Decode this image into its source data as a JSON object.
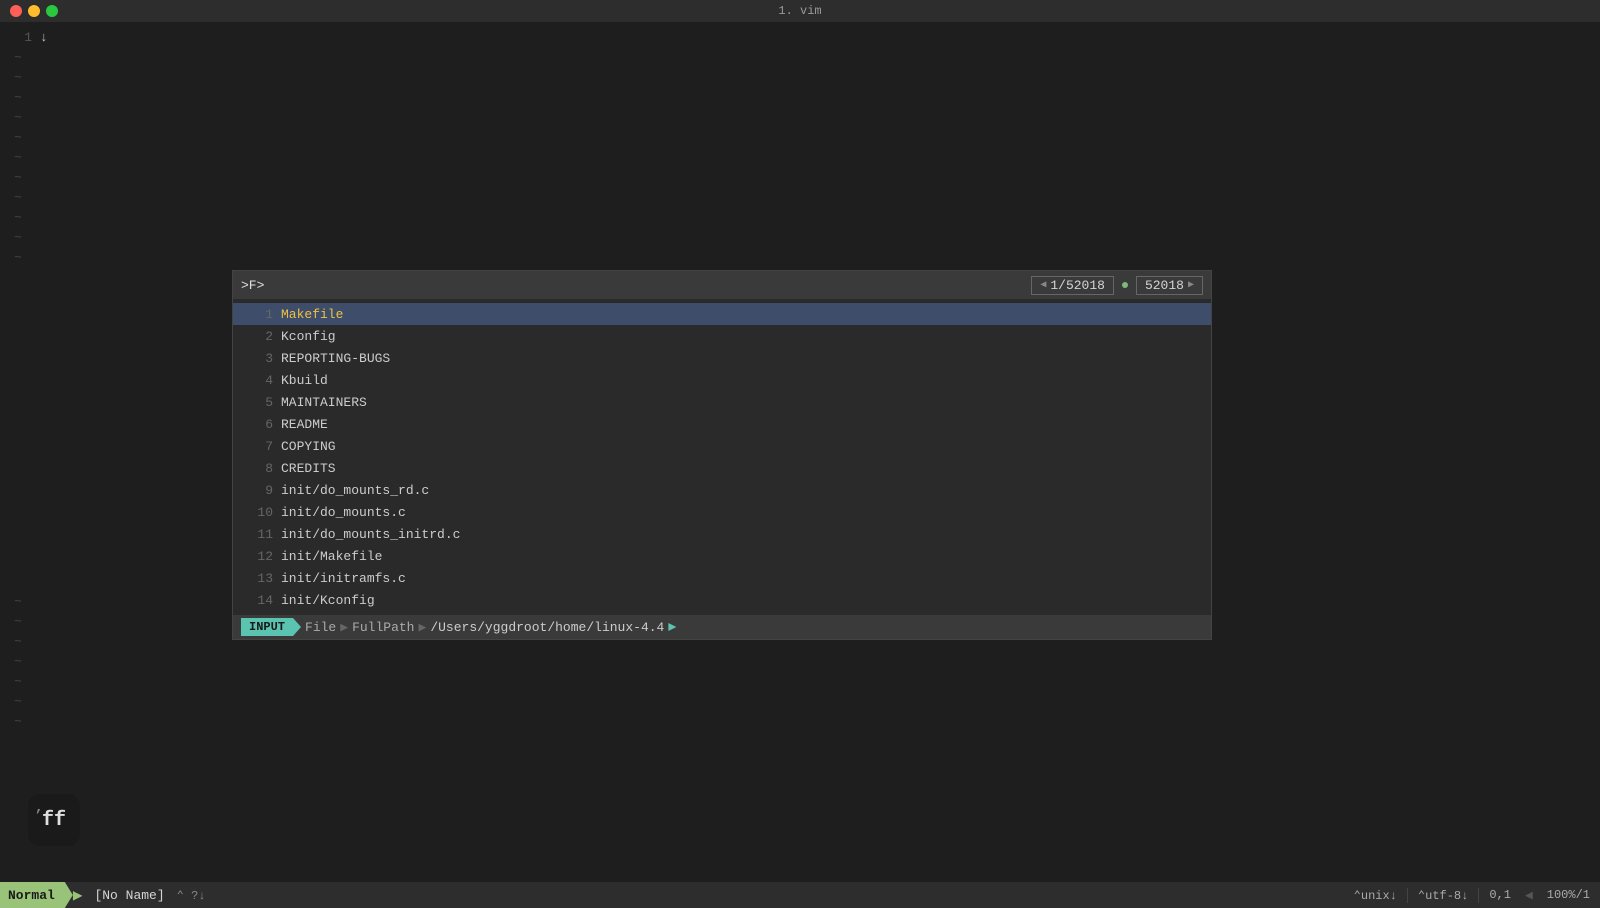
{
  "titlebar": {
    "title": "1. vim"
  },
  "editor": {
    "line_number": "1",
    "cursor_char": "↓"
  },
  "tilde_lines": [
    "~",
    "~",
    "~",
    "~",
    "~",
    "~",
    "~",
    "~",
    "~",
    "~",
    "~"
  ],
  "fzf": {
    "prompt": ">F>",
    "counter_left": "1/52018",
    "counter_right": "52018",
    "items": [
      {
        "num": "1",
        "name": "Makefile",
        "selected": true
      },
      {
        "num": "2",
        "name": "Kconfig",
        "selected": false
      },
      {
        "num": "3",
        "name": "REPORTING-BUGS",
        "selected": false
      },
      {
        "num": "4",
        "name": "Kbuild",
        "selected": false
      },
      {
        "num": "5",
        "name": "MAINTAINERS",
        "selected": false
      },
      {
        "num": "6",
        "name": "README",
        "selected": false
      },
      {
        "num": "7",
        "name": "COPYING",
        "selected": false
      },
      {
        "num": "8",
        "name": "CREDITS",
        "selected": false
      },
      {
        "num": "9",
        "name": "init/do_mounts_rd.c",
        "selected": false
      },
      {
        "num": "10",
        "name": "init/do_mounts.c",
        "selected": false
      },
      {
        "num": "11",
        "name": "init/do_mounts_initrd.c",
        "selected": false
      },
      {
        "num": "12",
        "name": "init/Makefile",
        "selected": false
      },
      {
        "num": "13",
        "name": "init/initramfs.c",
        "selected": false
      },
      {
        "num": "14",
        "name": "init/Kconfig",
        "selected": false
      }
    ],
    "status": {
      "mode": "INPUT",
      "breadcrumb1": "File",
      "breadcrumb2": "FullPath",
      "path": "/Users/yggdroot/home/linux-4.4"
    }
  },
  "statusbar": {
    "mode": "Normal",
    "filename": "[No Name]",
    "flags": "⌃ ?↓",
    "fileformat": "unix↓",
    "encoding": "utf-8↓",
    "position": "0,1",
    "percent": "100%/1"
  },
  "ff_logo": {
    "comma": ",",
    "letters": "ff"
  }
}
